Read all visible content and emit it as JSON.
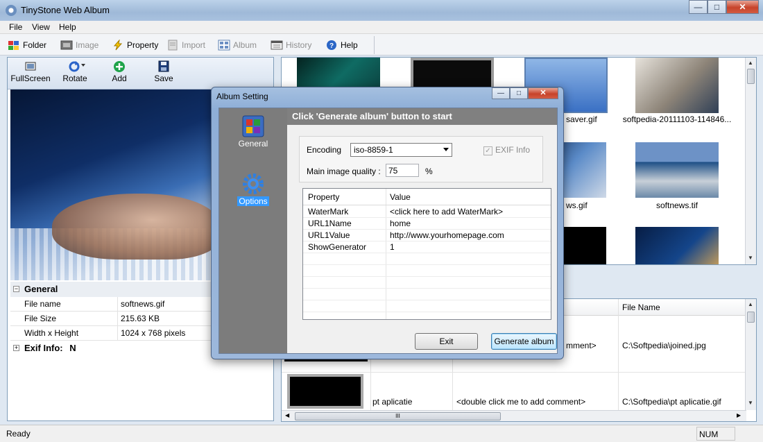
{
  "window": {
    "title": "TinyStone Web Album",
    "buttons": [
      "—",
      "□",
      "✕"
    ]
  },
  "menu": [
    "File",
    "View",
    "Help"
  ],
  "toolbar": {
    "items": [
      {
        "label": "Folder",
        "icon": "folder-icon",
        "enabled": true
      },
      {
        "label": "Image",
        "icon": "image-icon",
        "enabled": false
      },
      {
        "label": "Property",
        "icon": "property-icon",
        "enabled": true
      },
      {
        "label": "Import",
        "icon": "import-icon",
        "enabled": false
      },
      {
        "label": "Album",
        "icon": "album-icon",
        "enabled": false
      },
      {
        "label": "History",
        "icon": "history-icon",
        "enabled": false
      },
      {
        "label": "Help",
        "icon": "help-icon",
        "enabled": true
      }
    ]
  },
  "viewer_toolbar": {
    "items": [
      {
        "label": "FullScreen",
        "icon": "fullscreen-icon"
      },
      {
        "label": "Rotate",
        "icon": "rotate-icon"
      },
      {
        "label": "Add",
        "icon": "add-icon"
      },
      {
        "label": "Save",
        "icon": "save-icon"
      }
    ]
  },
  "properties": {
    "general_label": "General",
    "rows": [
      {
        "key": "File name",
        "value": "softnews.gif"
      },
      {
        "key": "File Size",
        "value": "215.63 KB"
      },
      {
        "key": "Width x Height",
        "value": "1024 x 768 pixels"
      }
    ],
    "exif_label": "Exif Info:",
    "exif_value": "N"
  },
  "thumbnails": {
    "captions": [
      "saver.gif",
      "softpedia-20111103-114846...",
      "ws.gif",
      "softnews.tif"
    ]
  },
  "file_list": {
    "headers": {
      "file_name": "File Name"
    },
    "rows": [
      {
        "comment": "mment>",
        "file_name": "C:\\Softpedia\\joined.jpg"
      },
      {
        "name": "pt aplicatie",
        "comment": "<double click me to add comment>",
        "file_name": "C:\\Softpedia\\pt aplicatie.gif"
      }
    ],
    "hscroll_grip": "III"
  },
  "status": {
    "left": "Ready",
    "right": "NUM"
  },
  "dialog": {
    "title": "Album Setting",
    "sidebar": [
      {
        "label": "General",
        "icon": "general-icon",
        "selected": false
      },
      {
        "label": "Options",
        "icon": "options-gear-icon",
        "selected": true
      }
    ],
    "header": "Click 'Generate album' button to start",
    "encoding_label": "Encoding",
    "encoding_value": "iso-8859-1",
    "exif_label": "EXIF Info",
    "exif_checked": true,
    "quality_label": "Main image quality :",
    "quality_value": "75",
    "quality_unit": "%",
    "grid": {
      "headers": [
        "Property",
        "Value"
      ],
      "rows": [
        {
          "property": "WaterMark",
          "value": "<click here to add WaterMark>"
        },
        {
          "property": "URL1Name",
          "value": "home"
        },
        {
          "property": "URL1Value",
          "value": "http://www.yourhomepage.com"
        },
        {
          "property": "ShowGenerator",
          "value": "1"
        }
      ]
    },
    "exit_button": "Exit",
    "generate_button": "Generate album"
  }
}
